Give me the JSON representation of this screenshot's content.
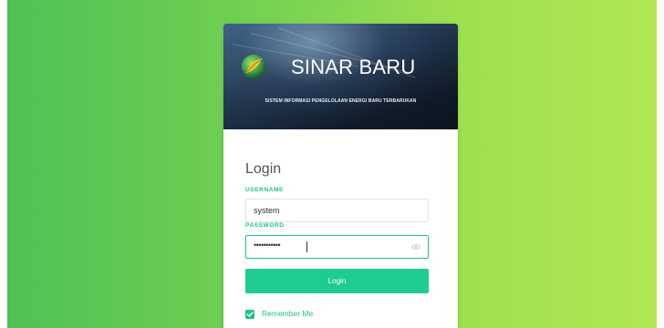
{
  "brand": {
    "title": "SINAR BARU",
    "subtitle": "SISTEM INFORMASI PENGELOLAAN ENERGI BARU TERBARUKAN",
    "logo_icon": "leaf-orb-logo-icon"
  },
  "form": {
    "title": "Login",
    "username_label": "USERNAME",
    "username_value": "system",
    "password_label": "PASSWORD",
    "password_value_masked": "•••••••••••",
    "password_toggle_icon": "eye-icon",
    "submit_label": "Login",
    "remember_label": "Remember Me",
    "remember_checked": true
  },
  "colors": {
    "accent": "#1fc18a",
    "button": "#1dcc8e",
    "background_start": "#4fc153",
    "background_end": "#b2e655",
    "banner_dark": "#0f1a28"
  }
}
